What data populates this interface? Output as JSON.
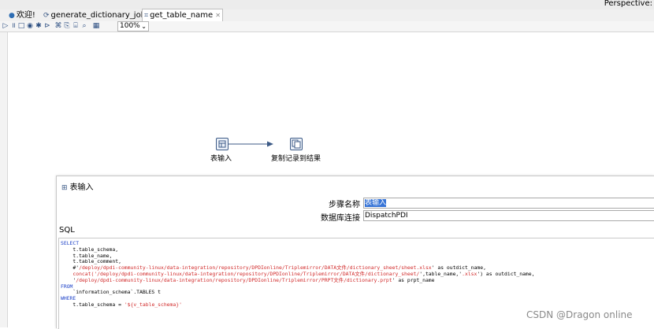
{
  "header": {
    "perspective_label": "Perspective:"
  },
  "tabs": [
    {
      "label": "欢迎!",
      "icon": "globe-icon"
    },
    {
      "label": "generate_dictionary_job",
      "icon": "job-icon"
    },
    {
      "label": "get_table_name",
      "icon": "transformation-icon",
      "close": "✕",
      "active": true
    }
  ],
  "toolbar": {
    "zoom": "100%"
  },
  "steps": [
    {
      "label": "表输入",
      "icon": "table-input-icon"
    },
    {
      "label": "复制记录到结果",
      "icon": "copy-rows-icon"
    }
  ],
  "dialog": {
    "title": "表输入",
    "step_name_label": "步骤名称",
    "step_name_value": "表输入",
    "connection_label": "数据库连接",
    "connection_value": "DispatchPDI",
    "sql_label": "SQL",
    "sql": [
      [
        {
          "t": "SELECT",
          "c": "kw"
        }
      ],
      [
        {
          "t": "    t.table_schema,",
          "c": ""
        }
      ],
      [
        {
          "t": "    t.table_name,",
          "c": ""
        }
      ],
      [
        {
          "t": "    t.table_comment,",
          "c": ""
        }
      ],
      [
        {
          "t": "    #'",
          "c": ""
        },
        {
          "t": "/deploy/dpdi-community-linux/data-integration/repository/DPDIonline/Triplemirror/DATA文件/dictionary_sheet/sheet.xlsx",
          "c": "str"
        },
        {
          "t": "' as outdict_name,",
          "c": ""
        }
      ],
      [
        {
          "t": "    concat('",
          "c": "str"
        },
        {
          "t": "/deploy/dpdi-community-linux/data-integration/repository/DPDIonline/Triplemirror/DATA文件/dictionary_sheet/",
          "c": "str"
        },
        {
          "t": "',table_name,'",
          "c": ""
        },
        {
          "t": ".xlsx",
          "c": "str"
        },
        {
          "t": "') as outdict_name,",
          "c": ""
        }
      ],
      [
        {
          "t": "    '",
          "c": ""
        },
        {
          "t": "/deploy/dpdi-community-linux/data-integration/repository/DPDIonline/Triplemirror/PRPT文件/dictionary.prpt",
          "c": "str"
        },
        {
          "t": "' as prpt_name",
          "c": ""
        }
      ],
      [
        {
          "t": "FROM",
          "c": "kw"
        }
      ],
      [
        {
          "t": "    `information_schema`.TABLES t",
          "c": ""
        }
      ],
      [
        {
          "t": "WHERE",
          "c": "kw"
        }
      ],
      [
        {
          "t": "    t.table_schema = ",
          "c": ""
        },
        {
          "t": "'${v_table_schema}'",
          "c": "str"
        }
      ]
    ]
  },
  "watermark": "CSDN @Dragon online"
}
